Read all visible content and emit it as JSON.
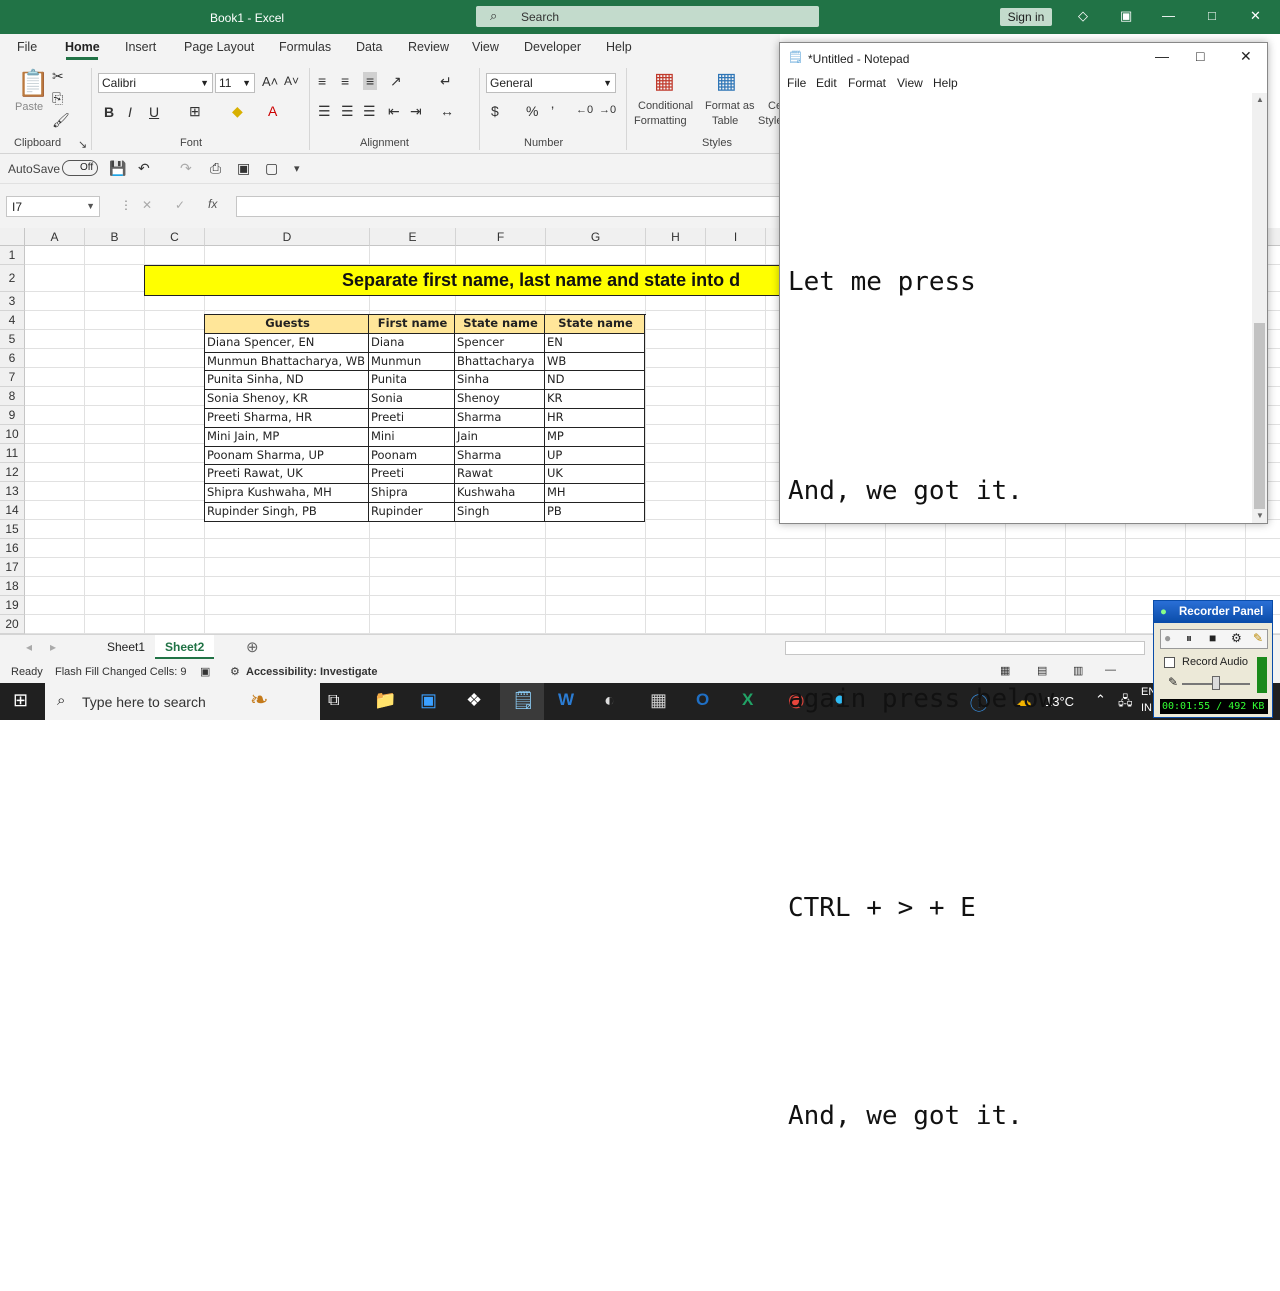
{
  "excel": {
    "title": "Book1  -  Excel",
    "search_placeholder": "Search",
    "signin": "Sign in",
    "tabs": [
      "File",
      "Home",
      "Insert",
      "Page Layout",
      "Formulas",
      "Data",
      "Review",
      "View",
      "Developer",
      "Help"
    ],
    "ribbon": {
      "clipboard_label": "Clipboard",
      "paste_label": "Paste",
      "font_label": "Font",
      "font_name": "Calibri",
      "font_size": "11",
      "alignment_label": "Alignment",
      "number_label": "Number",
      "number_format": "General",
      "styles_label": "Styles",
      "cond_format": "Conditional",
      "cond_format2": "Formatting",
      "format_table": "Format as",
      "format_table2": "Table",
      "cell_styles": "Ce",
      "cell_styles2": "Style",
      "bold": "B",
      "italic": "I",
      "underline": "U"
    },
    "qat": {
      "autosave": "AutoSave",
      "toggle": "Off"
    },
    "name_box": "I7",
    "fx": "fx",
    "columns": [
      "A",
      "B",
      "C",
      "D",
      "E",
      "F",
      "G",
      "H",
      "I"
    ],
    "rows": [
      "1",
      "2",
      "3",
      "4",
      "5",
      "6",
      "7",
      "8",
      "9",
      "10",
      "11",
      "12",
      "13",
      "14",
      "15",
      "16",
      "17",
      "18",
      "19",
      "20"
    ],
    "banner": "Separate first name, last name and state into d",
    "table": {
      "headers": [
        "Guests",
        "First name",
        "State name",
        "State name"
      ],
      "rows": [
        [
          "Diana Spencer, EN",
          "Diana",
          "Spencer",
          "EN"
        ],
        [
          "Munmun Bhattacharya, WB",
          "Munmun",
          "Bhattacharya",
          "WB"
        ],
        [
          "Punita Sinha, ND",
          "Punita",
          "Sinha",
          "ND"
        ],
        [
          "Sonia Shenoy, KR",
          "Sonia",
          "Shenoy",
          "KR"
        ],
        [
          "Preeti Sharma, HR",
          "Preeti",
          "Sharma",
          "HR"
        ],
        [
          "Mini Jain, MP",
          "Mini",
          "Jain",
          "MP"
        ],
        [
          "Poonam Sharma, UP",
          "Poonam",
          "Sharma",
          "UP"
        ],
        [
          "Preeti Rawat, UK",
          "Preeti",
          "Rawat",
          "UK"
        ],
        [
          "Shipra Kushwaha, MH",
          "Shipra",
          "Kushwaha",
          "MH"
        ],
        [
          "Rupinder Singh, PB",
          "Rupinder",
          "Singh",
          "PB"
        ]
      ]
    },
    "sheets": [
      "Sheet1",
      "Sheet2"
    ],
    "status": {
      "ready": "Ready",
      "flash": "Flash Fill Changed Cells: 9",
      "accessibility": "Accessibility: Investigate"
    }
  },
  "notepad": {
    "title": "*Untitled - Notepad",
    "menu": [
      "File",
      "Edit",
      "Format",
      "View",
      "Help"
    ],
    "lines": [
      "Let me press",
      "And, we got it.",
      "again press below",
      "CTRL + > + E",
      "And, we got it."
    ]
  },
  "recorder": {
    "title": "Recorder Panel",
    "record_audio": "Record Audio",
    "timer": "00:01:55 / 492 KB"
  },
  "taskbar": {
    "search": "Type here to search",
    "temp": "13°C",
    "lang1": "EN",
    "lang2": "IN"
  },
  "colors": {
    "excel_green": "#217346",
    "banner_yellow": "#ffff00",
    "header_fill": "#ffe699"
  }
}
